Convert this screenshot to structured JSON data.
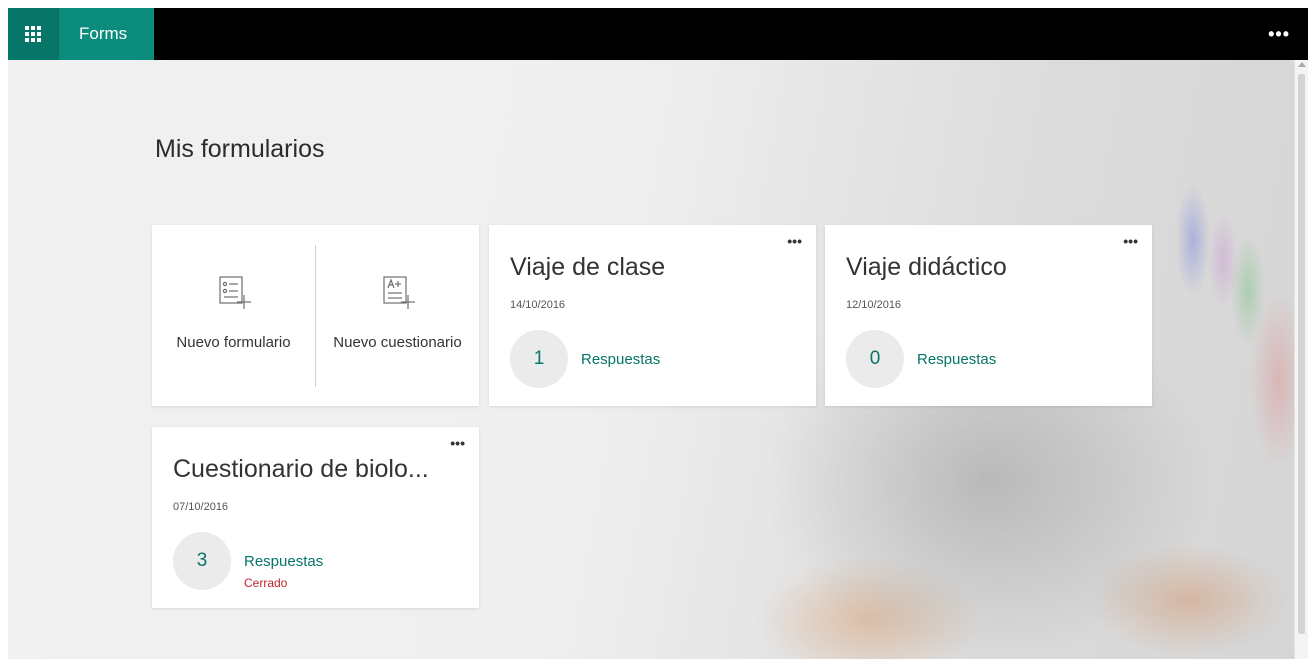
{
  "app": {
    "name": "Forms",
    "waffle_icon": "app-launcher-icon",
    "more_icon": "more-icon",
    "more_label": "•••",
    "accent": "#077568",
    "brand_bg": "#0b8c7c"
  },
  "page": {
    "title": "Mis formularios"
  },
  "new_items": {
    "form_label": "Nuevo formulario",
    "quiz_label": "Nuevo cuestionario",
    "form_icon": "new-form-icon",
    "quiz_icon": "new-quiz-icon"
  },
  "forms": [
    {
      "title": "Viaje de clase",
      "date": "14/10/2016",
      "responses": "1",
      "responses_label": "Respuestas",
      "more_label": "•••",
      "status": ""
    },
    {
      "title": "Viaje didáctico",
      "date": "12/10/2016",
      "responses": "0",
      "responses_label": "Respuestas",
      "more_label": "•••",
      "status": ""
    },
    {
      "title": "Cuestionario de biolo...",
      "date": "07/10/2016",
      "responses": "3",
      "responses_label": "Respuestas",
      "more_label": "•••",
      "status": "Cerrado"
    }
  ],
  "colors": {
    "status_closed": "#b8262b",
    "responses_text": "#077568"
  }
}
